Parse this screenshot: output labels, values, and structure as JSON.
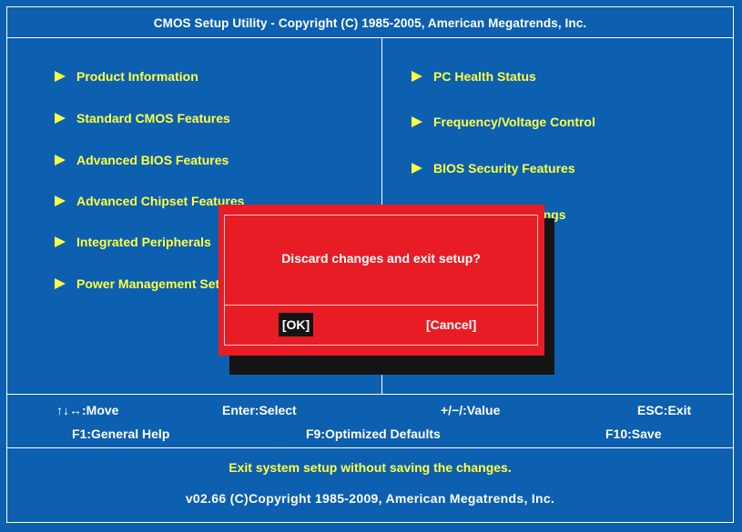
{
  "header": {
    "title": "CMOS Setup Utility - Copyright (C) 1985-2005, American Megatrends, Inc."
  },
  "menu_left": [
    {
      "label": "Product Information"
    },
    {
      "label": "Standard CMOS Features"
    },
    {
      "label": "Advanced BIOS Features"
    },
    {
      "label": "Advanced Chipset Features"
    },
    {
      "label": "Integrated Peripherals"
    },
    {
      "label": "Power Management Setup"
    }
  ],
  "menu_right": [
    {
      "label": "PC Health Status"
    },
    {
      "label": "Frequency/Voltage Control"
    },
    {
      "label": "BIOS Security Features"
    },
    {
      "label": "Green Power Settings"
    }
  ],
  "help": {
    "move": "↑↓↔:Move",
    "select": "Enter:Select",
    "value": "+/−/:Value",
    "exit": "ESC:Exit",
    "general_help": "F1:General Help",
    "optimized_defaults": "F9:Optimized Defaults",
    "save": "F10:Save"
  },
  "status": {
    "description": "Exit system setup without saving the changes.",
    "version": "v02.66 (C)Copyright 1985-2009, American Megatrends, Inc."
  },
  "dialog": {
    "message": "Discard changes and exit setup?",
    "ok_label": "[OK]",
    "cancel_label": "[Cancel]"
  },
  "colors": {
    "background": "#0d5fb0",
    "menu_text": "#ffff44",
    "dialog": "#e81c24",
    "shadow": "#141414"
  }
}
